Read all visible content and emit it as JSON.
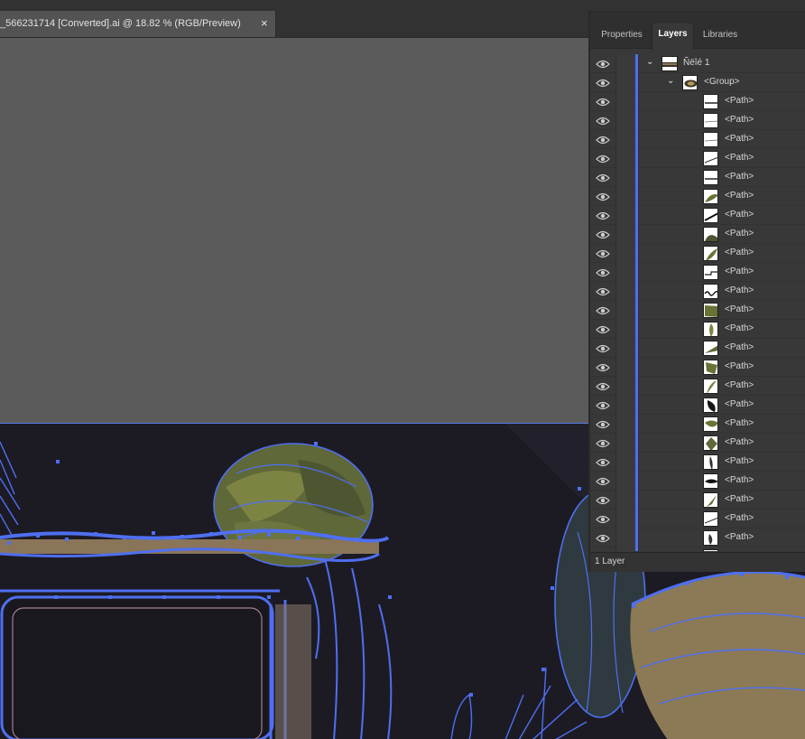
{
  "document_tab": {
    "title": "_566231714 [Converted].ai @ 18.82 % (RGB/Preview)",
    "close_glyph": "×"
  },
  "panel": {
    "tabs": [
      {
        "label": "Properties",
        "active": false
      },
      {
        "label": "Layers",
        "active": true
      },
      {
        "label": "Libraries",
        "active": false
      }
    ],
    "layers": [
      {
        "label": "Ñëîé 1",
        "kind": "layer",
        "expanded": true,
        "visible": true,
        "thumb": "scene"
      },
      {
        "label": "<Group>",
        "kind": "group",
        "expanded": true,
        "visible": true,
        "thumb": "group"
      },
      {
        "label": "<Path>",
        "kind": "path",
        "visible": true,
        "thumb": "line-flat"
      },
      {
        "label": "<Path>",
        "kind": "path",
        "visible": true,
        "thumb": "line-thin"
      },
      {
        "label": "<Path>",
        "kind": "path",
        "visible": true,
        "thumb": "line-thin"
      },
      {
        "label": "<Path>",
        "kind": "path",
        "visible": true,
        "thumb": "line-diag"
      },
      {
        "label": "<Path>",
        "kind": "path",
        "visible": true,
        "thumb": "line-flat"
      },
      {
        "label": "<Path>",
        "kind": "path",
        "visible": true,
        "thumb": "leaf-curve"
      },
      {
        "label": "<Path>",
        "kind": "path",
        "visible": true,
        "thumb": "line-diag-bold"
      },
      {
        "label": "<Path>",
        "kind": "path",
        "visible": true,
        "thumb": "leaf-mound"
      },
      {
        "label": "<Path>",
        "kind": "path",
        "visible": true,
        "thumb": "leaf-shoot"
      },
      {
        "label": "<Path>",
        "kind": "path",
        "visible": true,
        "thumb": "line-step"
      },
      {
        "label": "<Path>",
        "kind": "path",
        "visible": true,
        "thumb": "line-wave"
      },
      {
        "label": "<Path>",
        "kind": "path",
        "visible": true,
        "thumb": "leaf-block"
      },
      {
        "label": "<Path>",
        "kind": "path",
        "visible": true,
        "thumb": "leaf-narrow"
      },
      {
        "label": "<Path>",
        "kind": "path",
        "visible": true,
        "thumb": "leaf-wedge"
      },
      {
        "label": "<Path>",
        "kind": "path",
        "visible": true,
        "thumb": "leaf-flag"
      },
      {
        "label": "<Path>",
        "kind": "path",
        "visible": true,
        "thumb": "leaf-blade"
      },
      {
        "label": "<Path>",
        "kind": "path",
        "visible": true,
        "thumb": "leaf-dark"
      },
      {
        "label": "<Path>",
        "kind": "path",
        "visible": true,
        "thumb": "leaf-round"
      },
      {
        "label": "<Path>",
        "kind": "path",
        "visible": true,
        "thumb": "leaf-diamond"
      },
      {
        "label": "<Path>",
        "kind": "path",
        "visible": true,
        "thumb": "leaf-slim"
      },
      {
        "label": "<Path>",
        "kind": "path",
        "visible": true,
        "thumb": "leaf-black-curve"
      },
      {
        "label": "<Path>",
        "kind": "path",
        "visible": true,
        "thumb": "leaf-spike"
      },
      {
        "label": "<Path>",
        "kind": "path",
        "visible": true,
        "thumb": "line-diag"
      },
      {
        "label": "<Path>",
        "kind": "path",
        "visible": true,
        "thumb": "leaf-small"
      },
      {
        "label": "<Path>",
        "kind": "path",
        "visible": true,
        "thumb": "line-thin"
      }
    ],
    "footer": "1 Layer"
  },
  "colors": {
    "selection_blue": "#4f6ff0",
    "canvas_grey": "#5b5b5b",
    "artboard_dark": "#1c1b24",
    "panel_bg": "#383838",
    "leaf_olive": "#6a7236",
    "wood_tan": "#8a7558"
  },
  "icons": {
    "visibility": "eye-icon",
    "expand": "chevron-down-icon",
    "close": "close-icon"
  }
}
